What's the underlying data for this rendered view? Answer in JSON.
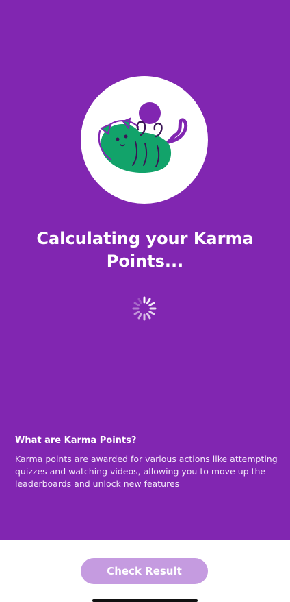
{
  "screen": {
    "title": "Calculating your Karma Points...",
    "loading_indicator": "spinner-icon"
  },
  "illustration": {
    "icon": "karma-cat-illustration-icon"
  },
  "info": {
    "heading": "What are Karma Points?",
    "body": "Karma points are awarded for various actions like attempting quizzes and watching videos, allowing you to move up the leaderboards and unlock new features"
  },
  "footer": {
    "check_result_label": "Check Result"
  },
  "colors": {
    "background": "#8126b1",
    "button": "#c59be0",
    "illustration_green": "#12a36a",
    "illustration_purple": "#8126b1"
  }
}
